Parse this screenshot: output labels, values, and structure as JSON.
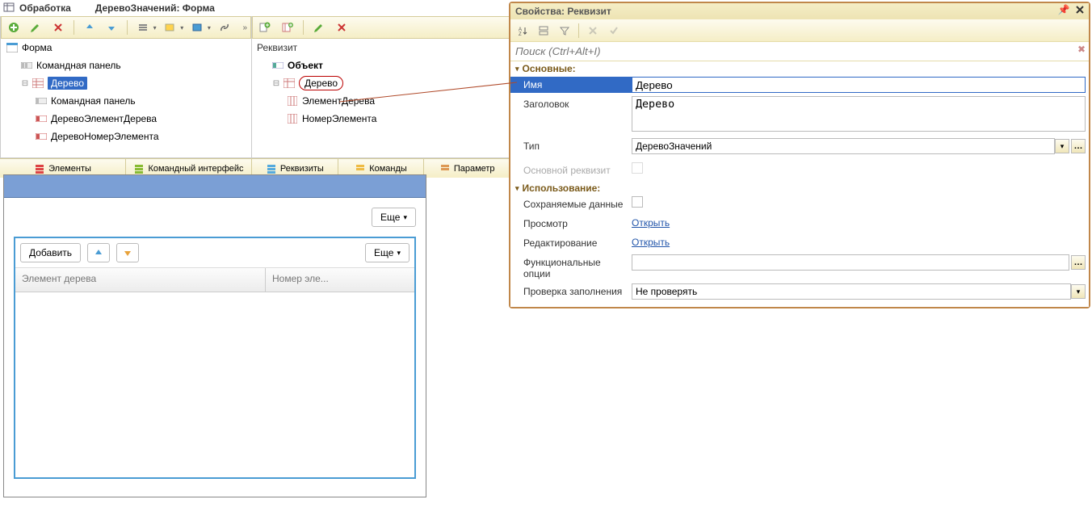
{
  "title": {
    "main": "Обработка",
    "sub": "ДеревоЗначений: Форма"
  },
  "left_tree": {
    "root": "Форма",
    "items": [
      "Командная панель",
      "Дерево",
      "Командная панель",
      "ДеревоЭлементДерева",
      "ДеревоНомерЭлемента"
    ]
  },
  "left_tabs": [
    "Элементы",
    "Командный интерфейс"
  ],
  "right_tree": {
    "title": "Реквизит",
    "root": "Объект",
    "node": "Дерево",
    "children": [
      "ЭлементДерева",
      "НомерЭлемента"
    ]
  },
  "right_tabs": [
    "Реквизиты",
    "Команды",
    "Параметр"
  ],
  "preview": {
    "more": "Еще",
    "add": "Добавить",
    "col1": "Элемент дерева",
    "col2": "Номер эле..."
  },
  "props": {
    "title": "Свойства: Реквизит",
    "search_placeholder": "Поиск (Ctrl+Alt+I)",
    "sec_main": "Основные:",
    "name_label": "Имя",
    "name_value": "Дерево",
    "title_label": "Заголовок",
    "title_value": "Дерево",
    "type_label": "Тип",
    "type_value": "ДеревоЗначений",
    "main_req": "Основной реквизит",
    "sec_usage": "Использование:",
    "saved_label": "Сохраняемые данные",
    "view_label": "Просмотр",
    "view_value": "Открыть",
    "edit_label": "Редактирование",
    "edit_value": "Открыть",
    "func_label": "Функциональные опции",
    "check_label": "Проверка заполнения",
    "check_value": "Не проверять"
  }
}
